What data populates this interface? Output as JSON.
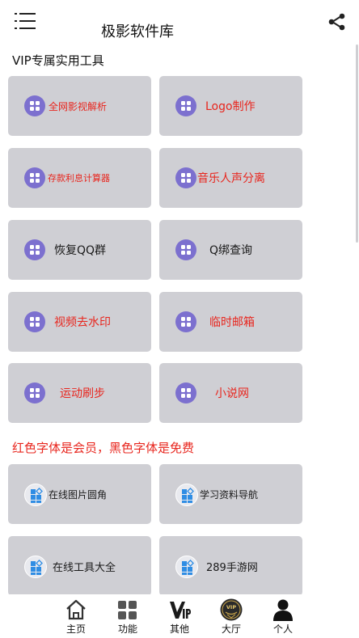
{
  "header": {
    "title": "极影软件库",
    "menu_icon": "hamburger-menu-icon",
    "share_icon": "share-icon"
  },
  "vip_section": {
    "title": "VIP专属实用工具",
    "items": [
      {
        "label": "全网影视解析",
        "color": "red"
      },
      {
        "label": "Logo制作",
        "color": "red"
      },
      {
        "label": "存款利息计算器",
        "color": "red"
      },
      {
        "label": "音乐人声分离",
        "color": "red"
      },
      {
        "label": "恢复QQ群",
        "color": "black"
      },
      {
        "label": "Q绑查询",
        "color": "black"
      },
      {
        "label": "视频去水印",
        "color": "red"
      },
      {
        "label": "临时邮箱",
        "color": "red"
      },
      {
        "label": "运动刷步",
        "color": "red"
      },
      {
        "label": "小说网",
        "color": "red"
      }
    ]
  },
  "note": "红色字体是会员，黑色字体是免费",
  "free_section": {
    "items": [
      {
        "label": "在线图片圆角"
      },
      {
        "label": "学习资料导航"
      },
      {
        "label": "在线工具大全"
      },
      {
        "label": "289手游网"
      }
    ]
  },
  "bottom_nav": [
    {
      "label": "主页",
      "icon": "home-icon"
    },
    {
      "label": "功能",
      "icon": "apps-grid-icon"
    },
    {
      "label": "其他",
      "icon": "vip-logo-icon"
    },
    {
      "label": "大厅",
      "icon": "vip-badge-icon"
    },
    {
      "label": "个人",
      "icon": "person-icon"
    }
  ],
  "colors": {
    "vip_text": "#e8261e",
    "free_text": "#1a1a1a",
    "card_bg": "#cfcfd4",
    "icon_purple": "#7c70cf",
    "icon_blue": "#2f8de4"
  }
}
